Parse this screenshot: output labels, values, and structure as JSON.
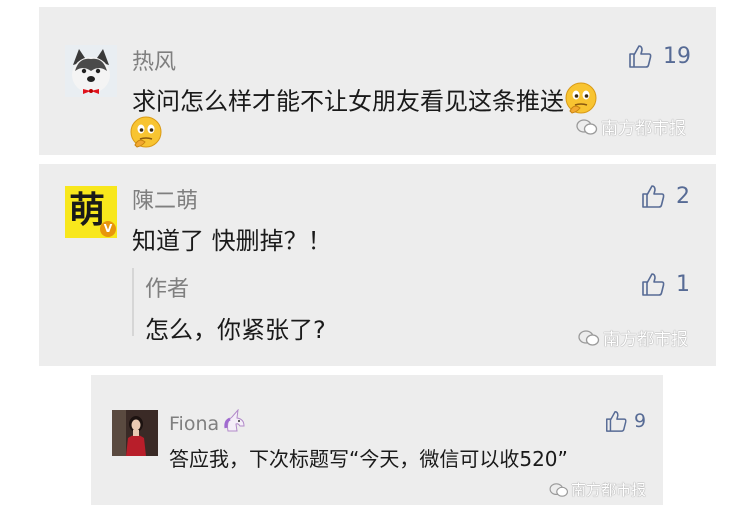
{
  "comments": [
    {
      "author": "热风",
      "text": "求问怎么样才能不让女朋友看见这条推送",
      "likes": "19",
      "avatar_icon": "husky-dog-avatar",
      "emojis": [
        "thinking-face-emoji",
        "thinking-face-emoji"
      ]
    },
    {
      "author": "陳二萌",
      "text": "知道了 快删掉？！",
      "likes": "2",
      "avatar_glyph": "萌",
      "avatar_badge": "V",
      "reply": {
        "author": "作者",
        "text": "怎么，你紧张了?",
        "likes": "1"
      }
    },
    {
      "author": "Fiona",
      "author_icon": "unicorn-icon",
      "text": "答应我，下次标题写“今天，微信可以收520”",
      "likes": "9",
      "avatar_icon": "portrait-photo-avatar"
    }
  ],
  "watermark": "南方都市报",
  "colors": {
    "card_bg": "#ededed",
    "like_blue": "#576b95",
    "name_gray": "#7f7f7f",
    "avatar_yellow": "#f8e71c"
  }
}
